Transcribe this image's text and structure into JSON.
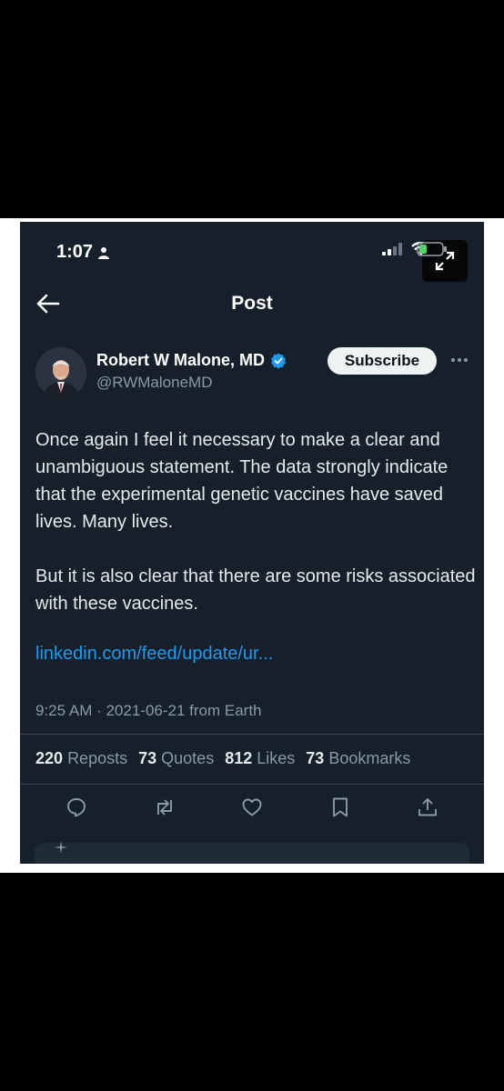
{
  "status_bar": {
    "time": "1:07"
  },
  "header": {
    "title": "Post"
  },
  "author": {
    "name": "Robert W Malone, MD",
    "handle": "@RWMaloneMD",
    "subscribe_label": "Subscribe"
  },
  "post": {
    "paragraph_1": "Once again I feel it necessary to make a clear and unambiguous statement. The data strongly indicate that the experimental genetic vaccines have saved lives. Many lives.",
    "paragraph_2": "But it is also clear that there are some risks associated with these vaccines.",
    "link": "linkedin.com/feed/update/ur...",
    "timestamp": "9:25 AM · 2021-06-21 from Earth"
  },
  "stats": [
    {
      "count": "220",
      "label": "Reposts"
    },
    {
      "count": "73",
      "label": "Quotes"
    },
    {
      "count": "812",
      "label": "Likes"
    },
    {
      "count": "73",
      "label": "Bookmarks"
    }
  ],
  "icons": {
    "reply": "reply-icon",
    "repost": "repost-icon",
    "like": "heart-icon",
    "bookmark": "bookmark-icon",
    "share": "share-icon"
  },
  "colors": {
    "background": "#15202b",
    "accent": "#1d9bf0",
    "text": "#e7e9ea",
    "muted": "#8b98a5"
  }
}
